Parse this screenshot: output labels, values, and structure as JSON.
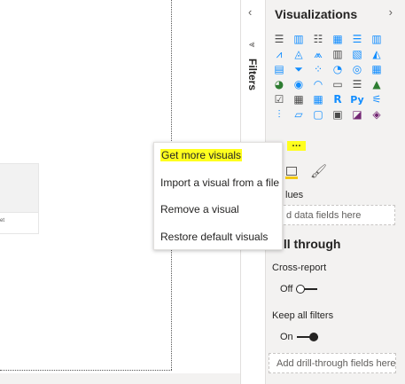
{
  "canvas": {
    "visual_card_label": "set"
  },
  "filters": {
    "label": "Filters",
    "collapse_glyph": "‹",
    "funnel_glyph": "⩔"
  },
  "viz_pane": {
    "title": "Visualizations",
    "expand_glyph": "›",
    "more_glyph": "…",
    "icons": [
      {
        "name": "stacked-bar-chart-icon",
        "glyph": "☰",
        "color": "#4a4a4a"
      },
      {
        "name": "stacked-column-chart-icon",
        "glyph": "▥",
        "color": "#118dff"
      },
      {
        "name": "clustered-bar-chart-icon",
        "glyph": "☷",
        "color": "#4a4a4a"
      },
      {
        "name": "clustered-column-chart-icon",
        "glyph": "▦",
        "color": "#118dff"
      },
      {
        "name": "100-stacked-bar-chart-icon",
        "glyph": "☰",
        "color": "#118dff"
      },
      {
        "name": "100-stacked-column-chart-icon",
        "glyph": "▥",
        "color": "#118dff"
      },
      {
        "name": "line-chart-icon",
        "glyph": "⩘",
        "color": "#118dff"
      },
      {
        "name": "area-chart-icon",
        "glyph": "◬",
        "color": "#118dff"
      },
      {
        "name": "stacked-area-chart-icon",
        "glyph": "⩕",
        "color": "#118dff"
      },
      {
        "name": "line-and-stacked-column-icon",
        "glyph": "▥",
        "color": "#4a4a4a"
      },
      {
        "name": "line-and-clustered-column-icon",
        "glyph": "▧",
        "color": "#118dff"
      },
      {
        "name": "ribbon-chart-icon",
        "glyph": "◭",
        "color": "#118dff"
      },
      {
        "name": "waterfall-chart-icon",
        "glyph": "▤",
        "color": "#118dff"
      },
      {
        "name": "funnel-chart-icon",
        "glyph": "⏷",
        "color": "#118dff"
      },
      {
        "name": "scatter-chart-icon",
        "glyph": "⁘",
        "color": "#118dff"
      },
      {
        "name": "pie-chart-icon",
        "glyph": "◔",
        "color": "#118dff"
      },
      {
        "name": "donut-chart-icon",
        "glyph": "◎",
        "color": "#118dff"
      },
      {
        "name": "treemap-icon",
        "glyph": "▦",
        "color": "#118dff"
      },
      {
        "name": "map-icon",
        "glyph": "◕",
        "color": "#2e7d32"
      },
      {
        "name": "filled-map-icon",
        "glyph": "◉",
        "color": "#118dff"
      },
      {
        "name": "gauge-icon",
        "glyph": "◠",
        "color": "#118dff"
      },
      {
        "name": "card-icon",
        "glyph": "▭",
        "color": "#4a4a4a"
      },
      {
        "name": "multi-row-card-icon",
        "glyph": "☰",
        "color": "#4a4a4a"
      },
      {
        "name": "kpi-icon",
        "glyph": "▲",
        "color": "#2e7d32"
      },
      {
        "name": "slicer-icon",
        "glyph": "☑",
        "color": "#4a4a4a"
      },
      {
        "name": "table-icon",
        "glyph": "▦",
        "color": "#4a4a4a"
      },
      {
        "name": "matrix-icon",
        "glyph": "▦",
        "color": "#118dff"
      },
      {
        "name": "r-visual-icon",
        "glyph": "R",
        "color": "#118dff"
      },
      {
        "name": "python-visual-icon",
        "glyph": "Py",
        "color": "#118dff"
      },
      {
        "name": "key-influencers-icon",
        "glyph": "⚟",
        "color": "#118dff"
      },
      {
        "name": "decomposition-tree-icon",
        "glyph": "⫶",
        "color": "#118dff"
      },
      {
        "name": "qa-icon",
        "glyph": "▱",
        "color": "#118dff"
      },
      {
        "name": "smart-narrative-icon",
        "glyph": "▢",
        "color": "#118dff"
      },
      {
        "name": "paginated-report-icon",
        "glyph": "▣",
        "color": "#4a4a4a"
      },
      {
        "name": "power-apps-icon",
        "glyph": "◪",
        "color": "#742774"
      },
      {
        "name": "power-automate-icon",
        "glyph": "◈",
        "color": "#742774"
      }
    ],
    "values_label": "lues",
    "values_placeholder": "d data fields here",
    "drill_title": "ill through",
    "cross_report_label": "Cross-report",
    "cross_report_state": "Off",
    "keep_filters_label": "Keep all filters",
    "keep_filters_state": "On",
    "drill_placeholder": "Add drill-through fields here"
  },
  "context_menu": {
    "items": [
      {
        "label": "Get more visuals",
        "highlighted": true
      },
      {
        "label": "Import a visual from a file"
      },
      {
        "label": "Remove a visual"
      },
      {
        "label": "Restore default visuals"
      }
    ]
  }
}
